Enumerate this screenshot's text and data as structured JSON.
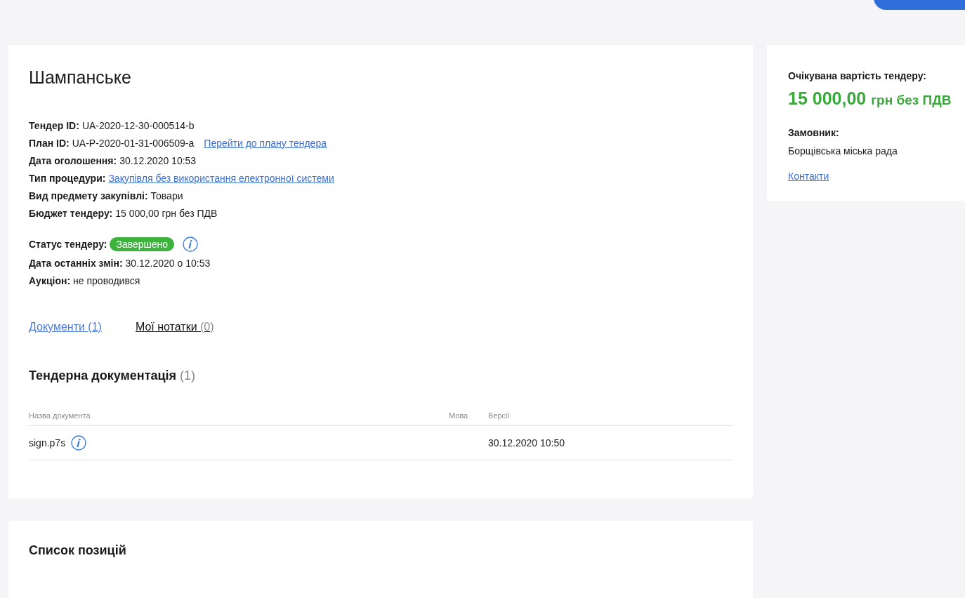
{
  "top_button": {
    "visible": true
  },
  "tender": {
    "title": "Шампанське",
    "details": [
      {
        "kind": "text",
        "label": "Тендер ID:",
        "value": "UA-2020-12-30-000514-b"
      },
      {
        "kind": "text_link",
        "label": "План ID:",
        "value": "UA-P-2020-01-31-006509-a",
        "link": "Перейти до плану тендера"
      },
      {
        "kind": "text",
        "label": "Дата оголошення:",
        "value": "30.12.2020 10:53"
      },
      {
        "kind": "link",
        "label": "Тип процедури:",
        "link": "Закупівля без використання електронної системи"
      },
      {
        "kind": "text",
        "label": "Вид предмету закупівлі:",
        "value": "Товари"
      },
      {
        "kind": "text",
        "label": "Бюджет тендеру:",
        "value": "15 000,00 грн без ПДВ"
      }
    ],
    "status_details": [
      {
        "kind": "status",
        "label": "Статус тендеру:",
        "value": "Завершено",
        "color": "#3db33d"
      },
      {
        "kind": "text",
        "label": "Дата останніх змін:",
        "value": "30.12.2020 о 10:53"
      },
      {
        "kind": "text",
        "label": "Аукціон:",
        "value": "не проводився"
      }
    ],
    "tabs": [
      {
        "label": "Документи",
        "count": "(1)",
        "selected": true
      },
      {
        "label": "Мої нотатки",
        "count": "(0)",
        "selected": false
      }
    ],
    "documentation": {
      "title": "Тендерна документація",
      "count": "(1)",
      "columns": [
        "Назва документа",
        "Мова",
        "Версії"
      ],
      "rows": [
        {
          "name": "sign.p7s",
          "language": "",
          "version": "30.12.2020 10:50"
        }
      ]
    }
  },
  "sidebar": {
    "expected_label": "Очікувана вартість тендеру:",
    "amount": "15 000,00",
    "currency": "грн без ПДВ",
    "customer_label": "Замовник:",
    "customer": "Борщівська міська рада",
    "contacts_link": "Контакти"
  },
  "positions": {
    "title": "Список позицій"
  }
}
